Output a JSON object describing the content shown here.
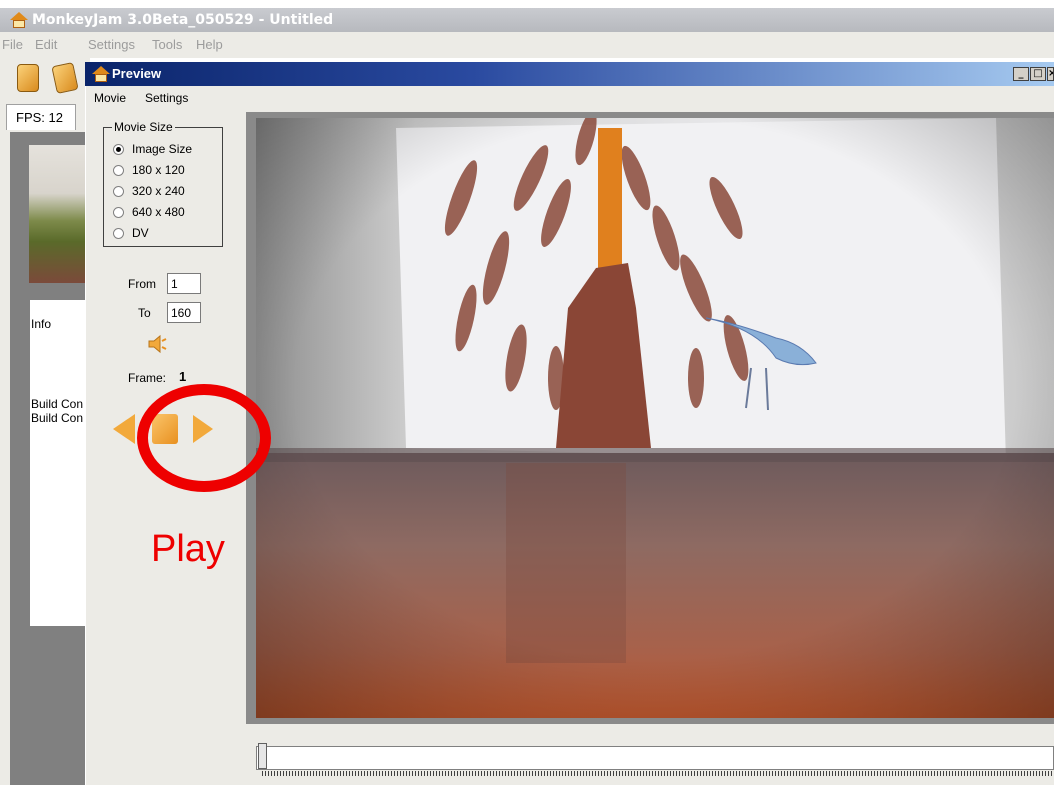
{
  "app": {
    "title": "MonkeyJam 3.0Beta_050529 - Untitled",
    "menu": [
      "File",
      "Edit",
      "Settings",
      "Tools",
      "Help"
    ],
    "fps_label": "FPS: 12",
    "info_label": "Info",
    "info_lines": [
      "Build Con",
      "Build Con"
    ]
  },
  "preview": {
    "title": "Preview",
    "menu": [
      "Movie",
      "Settings"
    ],
    "window_buttons": [
      "_",
      "□",
      "×"
    ],
    "movie_size": {
      "legend": "Movie Size",
      "options": [
        "Image Size",
        "180 x 120",
        "320 x 240",
        "640 x 480",
        "DV"
      ],
      "selected": "Image Size"
    },
    "from_label": "From",
    "from_value": "1",
    "to_label": "To",
    "to_value": "160",
    "frame_label": "Frame:",
    "frame_value": "1",
    "scrubber_position": 0
  },
  "annotation": {
    "text": "Play",
    "color": "#ee0000"
  },
  "icons": {
    "app": "house-icon",
    "sound": "speaker-icon",
    "prev": "triangle-left-icon",
    "stop": "stop-square-icon",
    "play": "triangle-right-icon"
  },
  "colors": {
    "accent_orange": "#f2a93b",
    "titlebar_blue": "#0a246a"
  }
}
